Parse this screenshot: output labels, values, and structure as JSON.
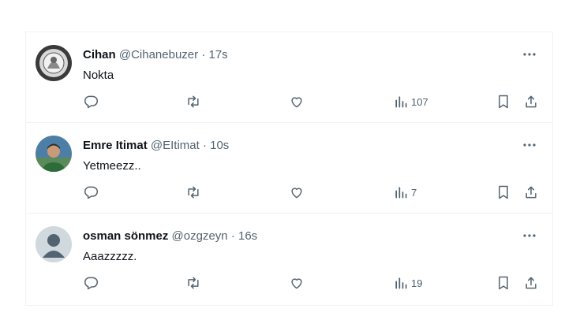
{
  "tweets": [
    {
      "name": "Cihan",
      "handle": "@Cihanebuzer",
      "sep": "·",
      "time": "17s",
      "text": "Nokta",
      "views": "107",
      "avatar": "bw-emblem"
    },
    {
      "name": "Emre Itimat",
      "handle": "@EItimat",
      "sep": "·",
      "time": "10s",
      "text": "Yetmeezz..",
      "views": "7",
      "avatar": "photo"
    },
    {
      "name": "osman sönmez",
      "handle": "@ozgzeyn",
      "sep": "·",
      "time": "16s",
      "text": "Aaazzzzz.",
      "views": "19",
      "avatar": "default-person"
    }
  ],
  "colors": {
    "text": "#0f1419",
    "secondary": "#536471",
    "border": "#eff3f4"
  },
  "icons": [
    "reply-icon",
    "retweet-icon",
    "like-icon",
    "views-icon",
    "bookmark-icon",
    "share-icon",
    "more-icon"
  ]
}
